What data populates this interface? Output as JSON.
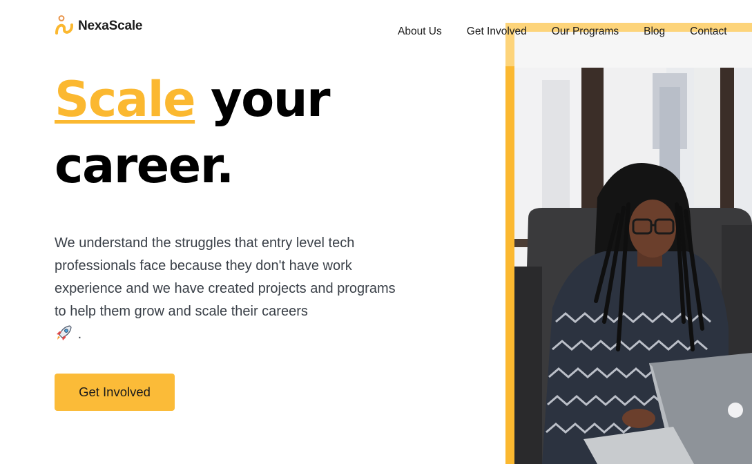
{
  "brand": {
    "name": "NexaScale",
    "logo_icon": "figure-logo-icon",
    "accent_color": "#fbb830"
  },
  "nav": {
    "items": [
      {
        "label": "About Us"
      },
      {
        "label": "Get Involved"
      },
      {
        "label": "Our Programs"
      },
      {
        "label": "Blog"
      },
      {
        "label": "Contact"
      }
    ]
  },
  "hero": {
    "headline_accent": "Scale",
    "headline_rest": "your",
    "headline_line2": "career.",
    "description": "We understand the struggles that entry level tech professionals face because they don't have work experience and we have created projects and programs to help them grow and scale their careers",
    "description_end": ".",
    "emoji": "rocket-icon",
    "cta_label": "Get Involved",
    "image": "woman-typing-on-laptop-photo"
  }
}
